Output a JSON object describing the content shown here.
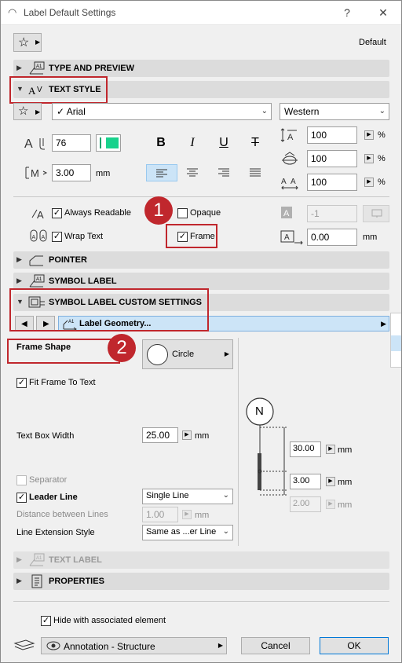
{
  "window": {
    "title": "Label Default Settings",
    "help": "?",
    "close": "✕"
  },
  "favorites": {
    "current": "Default"
  },
  "sections": {
    "type_preview": "TYPE AND PREVIEW",
    "text_style": "TEXT STYLE",
    "pointer": "POINTER",
    "symbol_label": "SYMBOL LABEL",
    "symbol_custom": "SYMBOL LABEL CUSTOM SETTINGS",
    "text_label": "TEXT LABEL",
    "properties": "PROPERTIES"
  },
  "text_style": {
    "font": "Arial",
    "script": "Western",
    "pen": "76",
    "size": "3.00",
    "size_unit": "mm",
    "width_factor": "100",
    "spacing_factor": "100",
    "slant_factor": "100",
    "percent": "%",
    "bold": "B",
    "italic": "I",
    "underline": "U",
    "strike": "T"
  },
  "options": {
    "always_readable": "Always Readable",
    "opaque": "Opaque",
    "wrap_text": "Wrap Text",
    "frame": "Frame",
    "opaque_pen": "-1",
    "offset": "0.00",
    "offset_unit": "mm"
  },
  "custom": {
    "panel": "Label Geometry...",
    "frame_shape_label": "Frame Shape",
    "frame_shape": "Circle",
    "fit_frame": "Fit Frame To Text",
    "text_box_width_label": "Text Box Width",
    "text_box_width": "25.00",
    "separator": "Separator",
    "leader_line": "Leader Line",
    "leader_line_value": "Single Line",
    "distance_label": "Distance between Lines",
    "distance_value": "1.00",
    "ext_style_label": "Line Extension Style",
    "ext_style_value": "Same as ...er Line",
    "mm": "mm",
    "preview_letter": "N",
    "dim1": "30.00",
    "dim2": "3.00",
    "dim3": "2.00"
  },
  "footer": {
    "hide_with_element": "Hide with associated element",
    "layer": "Annotation - Structure",
    "cancel": "Cancel",
    "ok": "OK"
  },
  "callouts": {
    "one": "1",
    "two": "2"
  }
}
